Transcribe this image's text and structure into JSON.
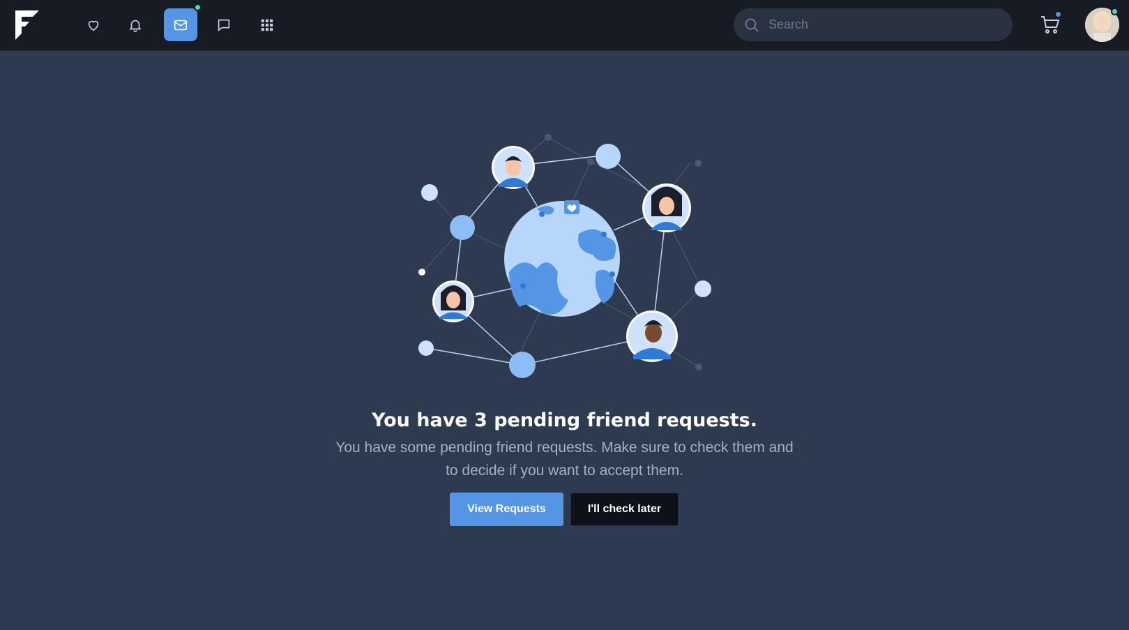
{
  "brand": {
    "logo_icon": "f-logo-icon"
  },
  "nav": {
    "items": [
      {
        "icon": "heart-icon",
        "active": false
      },
      {
        "icon": "bell-icon",
        "active": false
      },
      {
        "icon": "envelope-icon",
        "active": true,
        "badge": true
      },
      {
        "icon": "chat-bubble-icon",
        "active": false
      },
      {
        "icon": "grid-icon",
        "active": false
      }
    ]
  },
  "search": {
    "placeholder": "Search",
    "icon": "search-icon"
  },
  "cart": {
    "icon": "cart-icon",
    "badge": true
  },
  "profile": {
    "icon": "avatar",
    "online": true
  },
  "colors": {
    "accent": "#5595e5",
    "online": "#3fd9c4",
    "background": "#2e3a4f",
    "topbar": "#171b23"
  },
  "main": {
    "title": "You have 3 pending friend requests.",
    "description": "You have some pending friend requests. Make sure to check them and to decide if you want to accept them.",
    "primary_button": "View Requests",
    "secondary_button": "I'll check later"
  }
}
